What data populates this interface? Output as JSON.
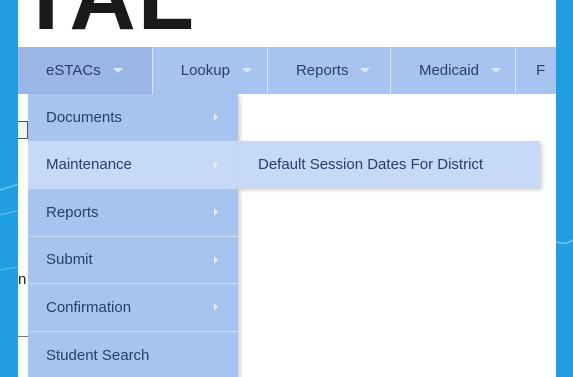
{
  "logo": {
    "text": "TAL"
  },
  "nav": {
    "items": [
      {
        "label": "eSTACs"
      },
      {
        "label": "Lookup"
      },
      {
        "label": "Reports"
      },
      {
        "label": "Medicaid"
      },
      {
        "label": "F"
      }
    ]
  },
  "dropdown": {
    "items": [
      {
        "label": "Documents"
      },
      {
        "label": "Maintenance"
      },
      {
        "label": "Reports"
      },
      {
        "label": "Submit"
      },
      {
        "label": "Confirmation"
      },
      {
        "label": "Student Search"
      }
    ]
  },
  "submenu": {
    "label": "Default Session Dates For District"
  },
  "fragments": {
    "letter": "n"
  }
}
